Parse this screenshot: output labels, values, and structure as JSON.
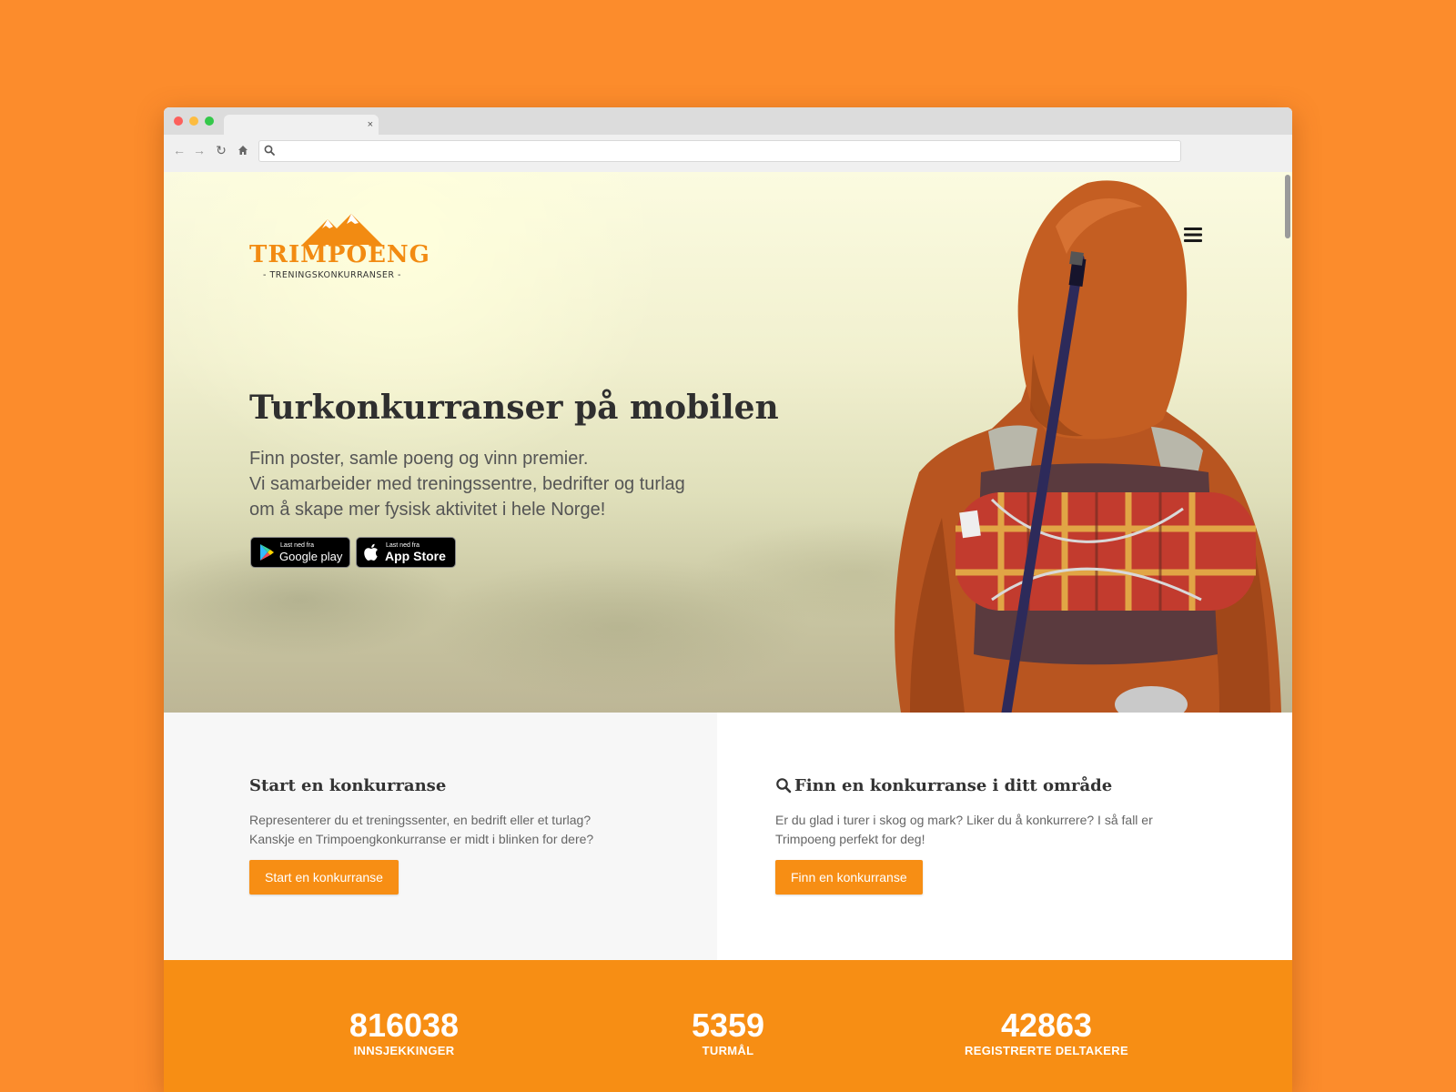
{
  "browser": {
    "tab_close": "×",
    "url": ""
  },
  "site": {
    "logo_name": "TRIMPOENG",
    "logo_tagline": "- TRENINGSKONKURRANSER -"
  },
  "hero": {
    "title": "Turkonkurranser på mobilen",
    "lines": [
      "Finn poster, samle poeng og vinn premier.",
      "Vi samarbeider med treningssentre, bedrifter og turlag",
      "om å skape mer fysisk aktivitet i hele Norge!"
    ],
    "google_badge": {
      "small": "Last ned fra",
      "big": "Google play"
    },
    "apple_badge": {
      "small": "Last ned fra",
      "big": "App Store"
    }
  },
  "cards": {
    "start": {
      "title": "Start en konkurranse",
      "lines": [
        "Representerer du et treningssenter, en bedrift eller et turlag?",
        "Kanskje en Trimpoengkonkurranse er midt i blinken for dere?"
      ],
      "button": "Start en konkurranse"
    },
    "find": {
      "title": "Finn en konkurranse i ditt område",
      "lines": [
        "Er du glad i turer i skog og mark? Liker du å konkurrere? I så fall er",
        "Trimpoeng perfekt for deg!"
      ],
      "button": "Finn en konkurranse"
    }
  },
  "stats": [
    {
      "value": "816038",
      "label": "INNSJEKKINGER"
    },
    {
      "value": "5359",
      "label": "TURMÅL"
    },
    {
      "value": "42863",
      "label": "REGISTRERTE DELTAKERE"
    }
  ],
  "colors": {
    "background": "#fc8c2c",
    "accent": "#f78e14",
    "logo": "#f28b12"
  },
  "icons": [
    "back-arrow-icon",
    "forward-arrow-icon",
    "reload-icon",
    "home-icon",
    "search-icon",
    "hamburger-menu-icon",
    "google-play-icon",
    "apple-icon"
  ]
}
